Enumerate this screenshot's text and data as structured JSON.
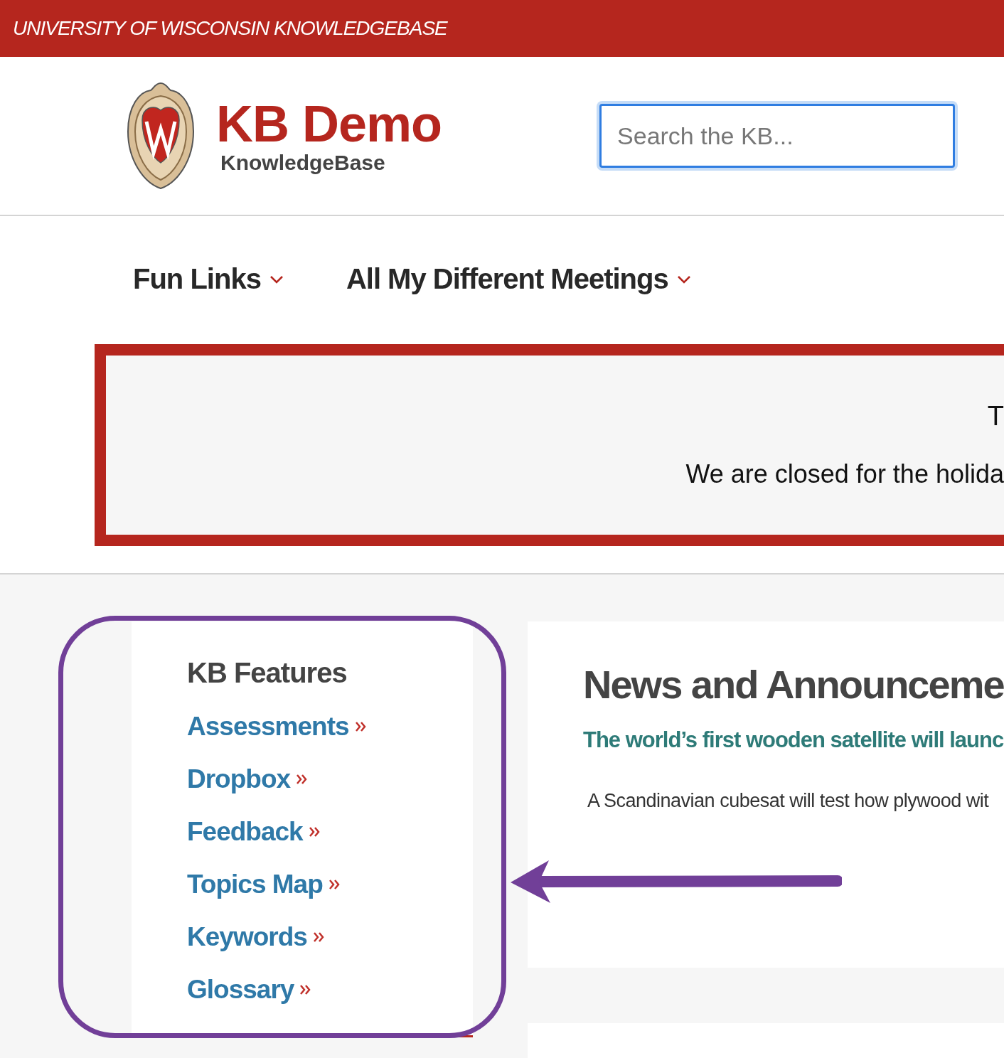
{
  "top_bar": {
    "title": "UNIVERSITY OF WISCONSIN KNOWLEDGEBASE"
  },
  "header": {
    "site_title": "KB Demo",
    "site_subtitle": "KnowledgeBase",
    "search": {
      "placeholder": "Search the KB..."
    }
  },
  "nav": {
    "items": [
      {
        "label": "Fun Links"
      },
      {
        "label": "All My Different Meetings"
      }
    ]
  },
  "alert": {
    "title": "T",
    "message": "We are closed for the holida"
  },
  "sidebar": {
    "title": "KB Features",
    "links": [
      {
        "label": "Assessments"
      },
      {
        "label": "Dropbox"
      },
      {
        "label": "Feedback"
      },
      {
        "label": "Topics Map"
      },
      {
        "label": "Keywords"
      },
      {
        "label": "Glossary"
      }
    ]
  },
  "news": {
    "title": "News and Announceme",
    "items": [
      {
        "headline": "The world’s first wooden satellite will launc",
        "summary": "A Scandinavian cubesat will test how plywood wit"
      }
    ]
  }
}
